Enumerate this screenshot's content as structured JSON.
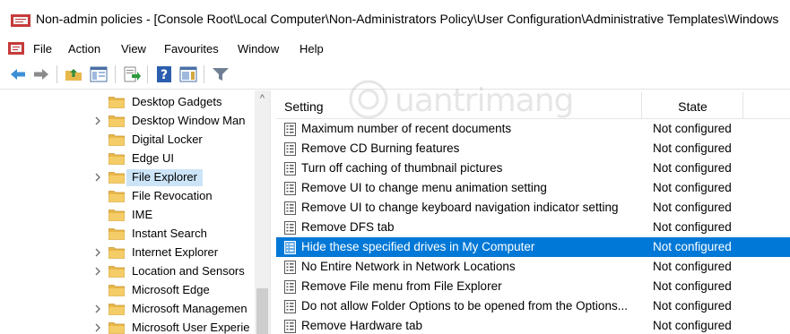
{
  "window": {
    "title": "Non-admin policies - [Console Root\\Local Computer\\Non-Administrators Policy\\User Configuration\\Administrative Templates\\Windows"
  },
  "menu": [
    {
      "label": "File"
    },
    {
      "label": "Action"
    },
    {
      "label": "View"
    },
    {
      "label": "Favourites"
    },
    {
      "label": "Window"
    },
    {
      "label": "Help"
    }
  ],
  "toolbar": {
    "icons": [
      "back-icon",
      "forward-icon",
      "up-folder-icon",
      "show-hide-tree-icon",
      "export-list-icon",
      "help-icon",
      "action-pane-icon",
      "filter-icon"
    ]
  },
  "tree": {
    "items": [
      {
        "label": "Desktop Gadgets",
        "expandable": false,
        "selected": false
      },
      {
        "label": "Desktop Window Man",
        "expandable": true,
        "selected": false
      },
      {
        "label": "Digital Locker",
        "expandable": false,
        "selected": false
      },
      {
        "label": "Edge UI",
        "expandable": false,
        "selected": false
      },
      {
        "label": "File Explorer",
        "expandable": true,
        "selected": true
      },
      {
        "label": "File Revocation",
        "expandable": false,
        "selected": false
      },
      {
        "label": "IME",
        "expandable": false,
        "selected": false
      },
      {
        "label": "Instant Search",
        "expandable": false,
        "selected": false
      },
      {
        "label": "Internet Explorer",
        "expandable": true,
        "selected": false
      },
      {
        "label": "Location and Sensors",
        "expandable": true,
        "selected": false
      },
      {
        "label": "Microsoft Edge",
        "expandable": false,
        "selected": false
      },
      {
        "label": "Microsoft Managemen",
        "expandable": true,
        "selected": false
      },
      {
        "label": "Microsoft User Experie",
        "expandable": true,
        "selected": false
      }
    ]
  },
  "list": {
    "columns": {
      "setting": "Setting",
      "state": "State"
    },
    "rows": [
      {
        "setting": "Maximum number of recent documents",
        "state": "Not configured",
        "selected": false
      },
      {
        "setting": "Remove CD Burning features",
        "state": "Not configured",
        "selected": false
      },
      {
        "setting": "Turn off caching of thumbnail pictures",
        "state": "Not configured",
        "selected": false
      },
      {
        "setting": "Remove UI to change menu animation setting",
        "state": "Not configured",
        "selected": false
      },
      {
        "setting": "Remove UI to change keyboard navigation indicator setting",
        "state": "Not configured",
        "selected": false
      },
      {
        "setting": "Remove DFS tab",
        "state": "Not configured",
        "selected": false
      },
      {
        "setting": "Hide these specified drives in My Computer",
        "state": "Not configured",
        "selected": true
      },
      {
        "setting": "No Entire Network in Network Locations",
        "state": "Not configured",
        "selected": false
      },
      {
        "setting": "Remove File menu from File Explorer",
        "state": "Not configured",
        "selected": false
      },
      {
        "setting": "Do not allow Folder Options to be opened from the Options...",
        "state": "Not configured",
        "selected": false
      },
      {
        "setting": "Remove Hardware tab",
        "state": "Not configured",
        "selected": false
      }
    ]
  },
  "colors": {
    "selection": "#0078d7",
    "tree_selection": "#cce4f7",
    "folder": "#e8b84a"
  }
}
